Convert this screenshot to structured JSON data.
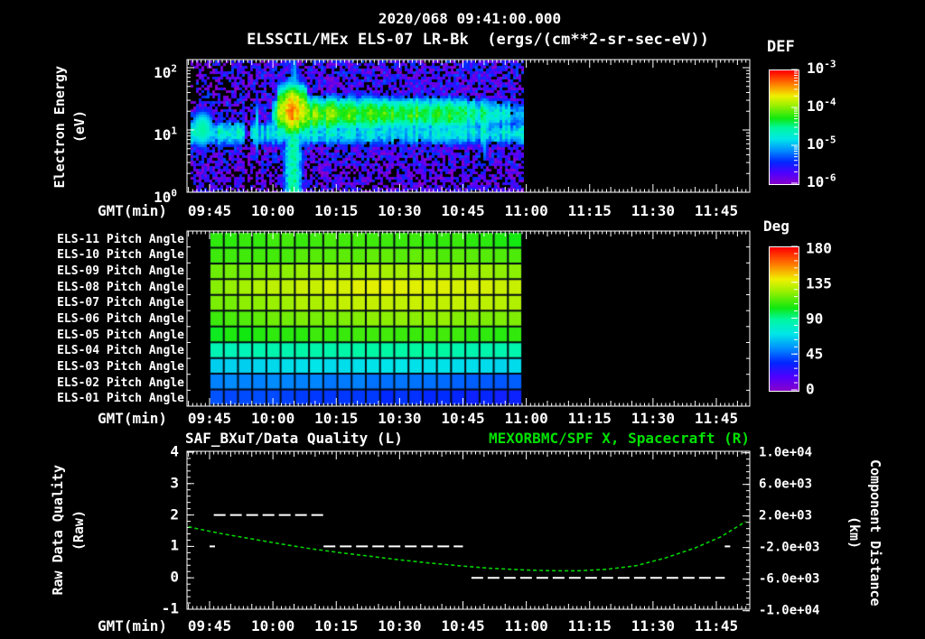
{
  "header": {
    "datetime": "2020/068 09:41:00.000",
    "instrument_title": "ELSSCIL/MEx ELS-07 LR-Bk  (ergs/(cm**2-sr-sec-eV))"
  },
  "colors": {
    "background": "#000000",
    "text": "#ffffff",
    "title_right_green": "#00e000",
    "curve_green": "#00d400",
    "quality_white": "#ffffff",
    "rainbow_stops": [
      [
        0,
        "#8a00c8"
      ],
      [
        0.1,
        "#5000ff"
      ],
      [
        0.2,
        "#0028ff"
      ],
      [
        0.3,
        "#0090ff"
      ],
      [
        0.4,
        "#00e8e8"
      ],
      [
        0.5,
        "#00f8a0"
      ],
      [
        0.58,
        "#10e810"
      ],
      [
        0.7,
        "#a0f000"
      ],
      [
        0.78,
        "#f0f000"
      ],
      [
        0.88,
        "#ff8000"
      ],
      [
        1,
        "#ff0000"
      ]
    ]
  },
  "axes": {
    "time": {
      "label": "GMT(min)",
      "tick_labels": [
        "09:45",
        "10:00",
        "10:15",
        "10:30",
        "10:45",
        "11:00",
        "11:15",
        "11:30",
        "11:45"
      ]
    },
    "electron_energy": {
      "label_line1": "Electron Energy",
      "label_line2": "(eV)",
      "tick_exponents": [
        "2",
        "1",
        "0"
      ]
    },
    "def_bar": {
      "title": "DEF",
      "tick_exponents": [
        "-3",
        "-4",
        "-5",
        "-6"
      ]
    },
    "deg_bar": {
      "title": "Deg",
      "tick_labels": [
        "180",
        "135",
        "90",
        "45",
        "0"
      ]
    },
    "raw_quality": {
      "label_line1": "Raw Data Quality",
      "label_line2": "(Raw)",
      "tick_labels": [
        "4",
        "3",
        "2",
        "1",
        "0",
        "-1"
      ]
    },
    "component_distance": {
      "label_line1": "Component Distance",
      "label_line2": "(km)",
      "tick_labels": [
        "1.0e+04",
        "6.0e+03",
        "2.0e+03",
        "-2.0e+03",
        "-6.0e+03",
        "-1.0e+04"
      ]
    }
  },
  "bottom_titles": {
    "left": "SAF_BXuT/Data Quality (L)",
    "right": "MEXORBMC/SPF X, Spacecraft (R)"
  },
  "chart_data": [
    {
      "type": "heatmap",
      "id": "electron-energy-spectrogram",
      "title": "ELSSCIL/MEx ELS-07 LR-Bk",
      "units": "ergs/(cm**2-sr-sec-eV)",
      "xlabel": "GMT(min)",
      "ylabel": "Electron Energy (eV)",
      "x_tick_labels": [
        "09:45",
        "10:00",
        "10:15",
        "10:30",
        "10:45",
        "11:00",
        "11:15",
        "11:30",
        "11:45"
      ],
      "y_scale": "log",
      "y_range_ev": [
        1,
        130
      ],
      "colorbar": {
        "title": "DEF",
        "scale": "log",
        "range_low": 1e-06,
        "range_high": 0.001
      },
      "data_time_range": [
        "09:40",
        "11:00"
      ],
      "model": {
        "time_start_min": -4.8,
        "time_end_min": 74.4,
        "background_log": -5.7,
        "background_noise": 0.42,
        "cyan_band": {
          "center_log_ev": 0.97,
          "width": 0.27,
          "amp_log": -4.8
        },
        "main_band": {
          "center_log_ev": 1.27,
          "width": 0.3,
          "onset_min": 15,
          "amp_log": -4.05,
          "late_amp_log": -4.35,
          "fade_start_min": 58,
          "end_min": 74.4
        },
        "burst": {
          "start_min": 16,
          "peak_min": 19.4,
          "end_min": 23,
          "amp_log": -3.38,
          "center_log_ev": 1.33,
          "width": 0.4
        },
        "early_blob": {
          "center_min": -2,
          "amp_log": -4.5,
          "center_log_ev": 1.03
        },
        "streaks_min": [
          11,
          65
        ],
        "gap_min": [
          7.8,
          9.6
        ]
      }
    },
    {
      "type": "heatmap",
      "id": "pitch-angle-grid",
      "colorbar": {
        "title": "Deg",
        "range": [
          0,
          180
        ]
      },
      "columns": 22,
      "time_range": [
        "09:45",
        "11:01"
      ],
      "rows": [
        {
          "label": "ELS-11 Pitch Angle",
          "angles_deg": {
            "start": 108,
            "mid": 112,
            "end": 106
          }
        },
        {
          "label": "ELS-10 Pitch Angle",
          "angles_deg": {
            "start": 110,
            "mid": 116,
            "end": 112
          }
        },
        {
          "label": "ELS-09 Pitch Angle",
          "angles_deg": {
            "start": 117,
            "mid": 127,
            "end": 123
          }
        },
        {
          "label": "ELS-08 Pitch Angle",
          "angles_deg": {
            "start": 123,
            "mid": 137,
            "end": 133
          }
        },
        {
          "label": "ELS-07 Pitch Angle",
          "angles_deg": {
            "start": 119,
            "mid": 132,
            "end": 129
          }
        },
        {
          "label": "ELS-06 Pitch Angle",
          "angles_deg": {
            "start": 112,
            "mid": 123,
            "end": 120
          }
        },
        {
          "label": "ELS-05 Pitch Angle",
          "angles_deg": {
            "start": 104,
            "mid": 111,
            "end": 108
          }
        },
        {
          "label": "ELS-04 Pitch Angle",
          "angles_deg": {
            "start": 84,
            "mid": 89,
            "end": 86
          }
        },
        {
          "label": "ELS-03 Pitch Angle",
          "angles_deg": {
            "start": 66,
            "mid": 71,
            "end": 68
          }
        },
        {
          "label": "ELS-02 Pitch Angle",
          "angles_deg": {
            "start": 52,
            "mid": 50,
            "end": 44
          }
        },
        {
          "label": "ELS-01 Pitch Angle",
          "angles_deg": {
            "start": 42,
            "mid": 38,
            "end": 33
          }
        }
      ]
    },
    {
      "type": "line",
      "id": "quality-and-spacecraft-x",
      "title_left": "SAF_BXuT/Data Quality (L)",
      "title_right": "MEXORBMC/SPF X, Spacecraft (R)",
      "left_axis": {
        "label": "Raw Data Quality (Raw)",
        "range": [
          -1,
          4
        ],
        "ticks": [
          4,
          3,
          2,
          1,
          0,
          -1
        ]
      },
      "right_axis": {
        "label": "Component Distance (km)",
        "range": [
          -10000,
          10000
        ],
        "tick_step": 4000
      },
      "series": [
        {
          "name": "SAF_BXuT/Data Quality",
          "axis": "left",
          "style": "dashed-white",
          "segments": [
            {
              "from": "09:46",
              "to": "10:12",
              "value": 2
            },
            {
              "from": "10:12",
              "to": "10:45",
              "value": 1
            },
            {
              "from": "10:47",
              "to": "11:47",
              "value": 0
            }
          ],
          "marks": [
            {
              "time": "09:45",
              "value": 1
            },
            {
              "time": "11:47",
              "value": 1
            }
          ]
        },
        {
          "name": "MEXORBMC/SPF X",
          "axis": "right",
          "style": "dotted-green",
          "points": [
            [
              "09:40",
              650
            ],
            [
              "09:41",
              500
            ],
            [
              "09:48",
              -250
            ],
            [
              "09:55",
              -900
            ],
            [
              "10:02",
              -1550
            ],
            [
              "10:09",
              -2150
            ],
            [
              "10:16",
              -2650
            ],
            [
              "10:23",
              -3100
            ],
            [
              "10:30",
              -3550
            ],
            [
              "10:37",
              -3950
            ],
            [
              "10:44",
              -4300
            ],
            [
              "10:51",
              -4600
            ],
            [
              "10:58",
              -4800
            ],
            [
              "11:05",
              -4930
            ],
            [
              "11:12",
              -4950
            ],
            [
              "11:19",
              -4750
            ],
            [
              "11:26",
              -4300
            ],
            [
              "11:33",
              -3300
            ],
            [
              "11:40",
              -2050
            ],
            [
              "11:46",
              -650
            ],
            [
              "11:52",
              1300
            ]
          ]
        }
      ]
    }
  ]
}
